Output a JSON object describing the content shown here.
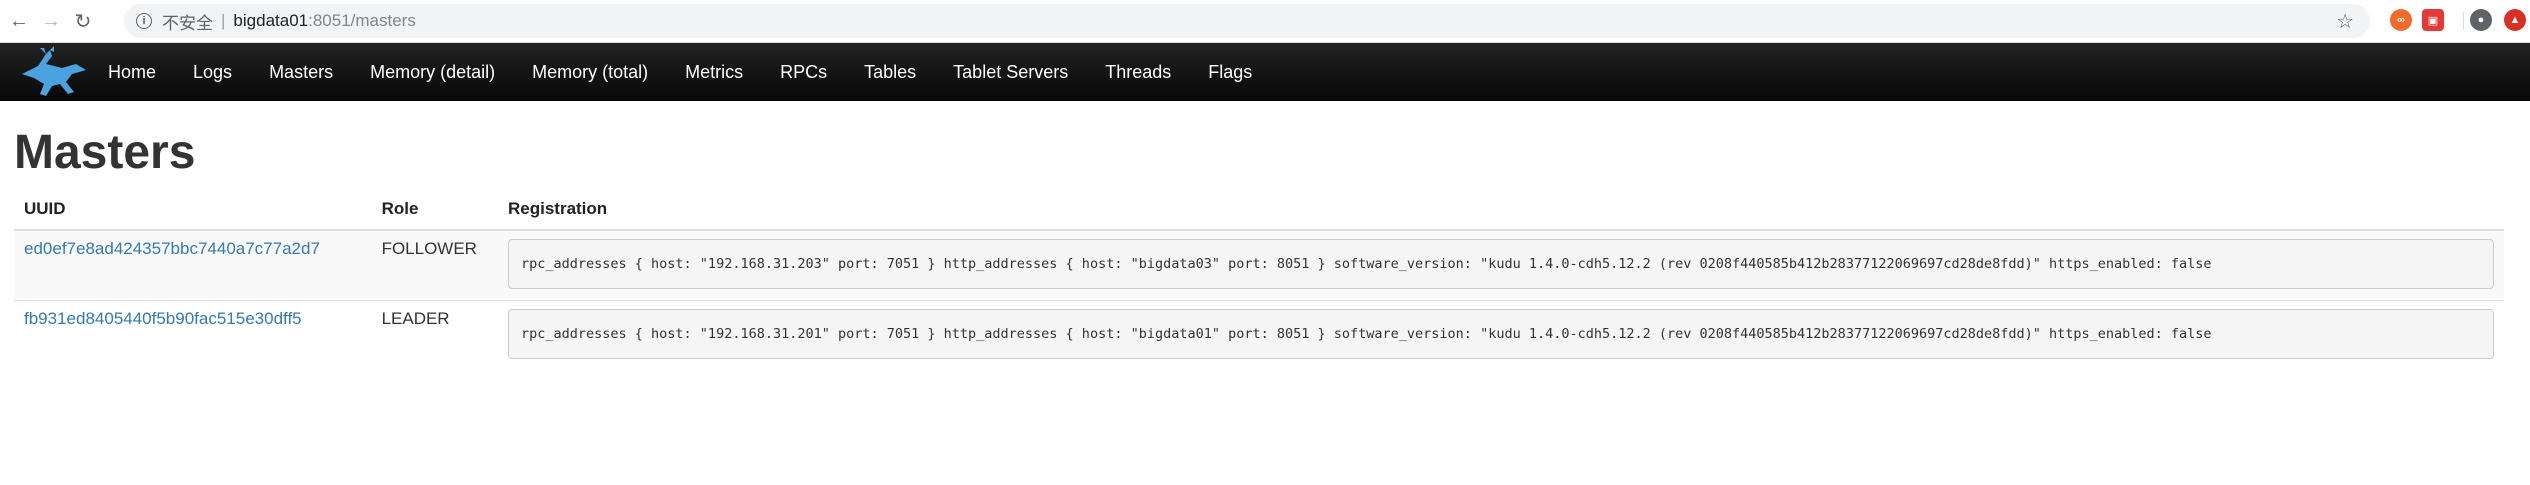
{
  "browser": {
    "insecure_label": "不安全",
    "separator": "|",
    "url_host": "bigdata01",
    "url_rest": ":8051/masters",
    "icons": [
      "back-icon",
      "forward-icon",
      "reload-icon",
      "info-icon",
      "star-icon"
    ]
  },
  "navbar": {
    "links": [
      "Home",
      "Logs",
      "Masters",
      "Memory (detail)",
      "Memory (total)",
      "Metrics",
      "RPCs",
      "Tables",
      "Tablet Servers",
      "Threads",
      "Flags"
    ],
    "background": "#111111",
    "link_color": "#ffffff"
  },
  "page": {
    "title": "Masters"
  },
  "table": {
    "headers": [
      "UUID",
      "Role",
      "Registration"
    ],
    "rows": [
      {
        "uuid": "ed0ef7e8ad424357bbc7440a7c77a2d7",
        "role": "FOLLOWER",
        "registration": "rpc_addresses { host: \"192.168.31.203\" port: 7051 } http_addresses { host: \"bigdata03\" port: 8051 } software_version: \"kudu 1.4.0-cdh5.12.2 (rev 0208f440585b412b28377122069697cd28de8fdd)\" https_enabled: false"
      },
      {
        "uuid": "fb931ed8405440f5b90fac515e30dff5",
        "role": "LEADER",
        "registration": "rpc_addresses { host: \"192.168.31.201\" port: 7051 } http_addresses { host: \"bigdata01\" port: 8051 } software_version: \"kudu 1.4.0-cdh5.12.2 (rev 0208f440585b412b28377122069697cd28de8fdd)\" https_enabled: false"
      }
    ],
    "link_color": "#337ab7"
  }
}
